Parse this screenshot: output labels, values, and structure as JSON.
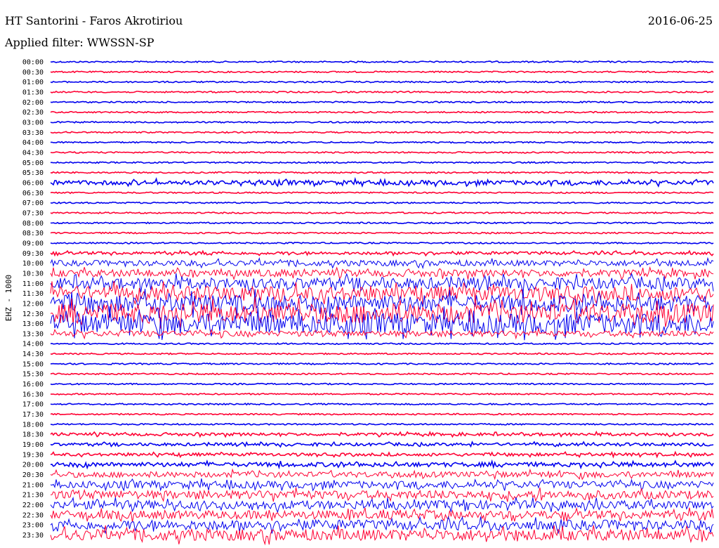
{
  "header": {
    "station": "HT Santorini - Faros Akrotiriou",
    "date": "2016-06-25",
    "filter": "Applied filter: WWSSN-SP"
  },
  "chart_data": {
    "type": "line",
    "title": "HT Santorini - Faros Akrotiriou",
    "ylabel": "EHZ - 1000",
    "grid": false,
    "legend": "none",
    "series_colors": [
      "#0000ee",
      "#ff0033"
    ],
    "tick_labels": [
      "00:00",
      "00:30",
      "01:00",
      "01:30",
      "02:00",
      "02:30",
      "03:00",
      "03:30",
      "04:00",
      "04:30",
      "05:00",
      "05:30",
      "06:00",
      "06:30",
      "07:00",
      "07:30",
      "08:00",
      "08:30",
      "09:00",
      "09:30",
      "10:00",
      "10:30",
      "11:00",
      "11:30",
      "12:00",
      "12:30",
      "13:00",
      "13:30",
      "14:00",
      "14:30",
      "15:00",
      "15:30",
      "16:00",
      "16:30",
      "17:00",
      "17:30",
      "18:00",
      "18:30",
      "19:00",
      "19:30",
      "20:00",
      "20:30",
      "21:00",
      "21:30",
      "22:00",
      "22:30",
      "23:00",
      "23:30"
    ],
    "trace_amplitude": [
      1,
      1,
      1,
      1,
      1,
      1,
      1,
      1,
      1,
      1,
      1,
      1,
      3,
      1,
      1,
      1,
      1,
      1,
      1,
      2,
      4,
      5,
      8,
      10,
      12,
      14,
      14,
      4,
      1,
      1,
      1,
      1,
      1,
      1,
      1,
      1,
      1,
      2,
      2,
      2,
      3,
      4,
      5,
      6,
      6,
      6,
      7,
      8
    ]
  }
}
